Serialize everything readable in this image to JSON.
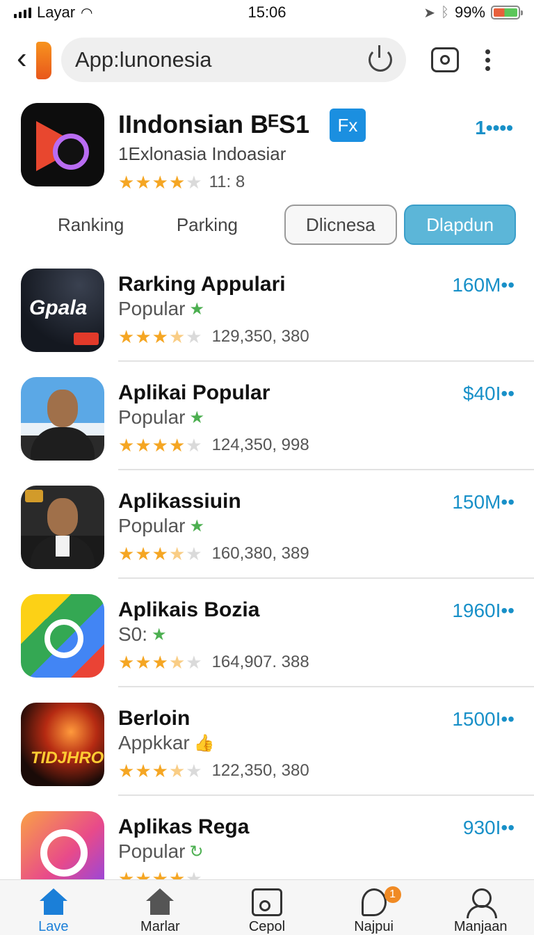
{
  "status": {
    "carrier": "Layar",
    "time": "15:06",
    "battery": "99%",
    "icons": [
      "signal-icon",
      "wifi-icon",
      "location-icon",
      "bluetooth-icon",
      "battery-icon"
    ]
  },
  "topbar": {
    "search_text": "App:lunonesia",
    "icons": [
      "back-icon",
      "power-icon",
      "camera-icon",
      "more-icon"
    ]
  },
  "app": {
    "title": "IIndonsian BᴱS1",
    "badge": "Fx",
    "subtitle": "1Exlonasia Indoasiar",
    "rating_text": "11: 8",
    "rating": 4,
    "more": "1••••"
  },
  "tabs": [
    {
      "label": "Ranking"
    },
    {
      "label": "Parking"
    },
    {
      "label": "Dlicnesa"
    },
    {
      "label": "Dlapdun"
    }
  ],
  "apps": [
    {
      "name": "Rarking Appulari",
      "category": "Popular",
      "count": "129,350, 380",
      "price": "160M••",
      "icon": "gpala",
      "icon_label": "Gpala",
      "rating": 3.5
    },
    {
      "name": "Aplikai Popular",
      "category": "Popular",
      "count": "124,350, 998",
      "price": "$40I••",
      "icon": "person",
      "rating": 4
    },
    {
      "name": "Aplikassiuin",
      "category": "Popular",
      "count": "160,380, 389",
      "price": "150M••",
      "icon": "person",
      "rating": 3.5
    },
    {
      "name": "Aplikais Bozia",
      "category": "S0:",
      "count": "164,907. 388",
      "price": "1960I••",
      "icon": "play",
      "rating": 3.5
    },
    {
      "name": "Berloin",
      "category": "Appkkar",
      "count": "122,350, 380",
      "price": "1500I••",
      "icon": "movie",
      "icon_label": "TIDJHRO",
      "rating": 3.5
    },
    {
      "name": "Aplikas Rega",
      "category": "Popular",
      "count": "",
      "price": "930I••",
      "icon": "insta",
      "rating": 4
    }
  ],
  "nav": [
    {
      "label": "Lave",
      "icon": "home-icon",
      "active": true
    },
    {
      "label": "Marlar",
      "icon": "store-icon"
    },
    {
      "label": "Cepol",
      "icon": "folder-icon"
    },
    {
      "label": "Najpui",
      "icon": "phone-icon",
      "badge": "1"
    },
    {
      "label": "Manjaan",
      "icon": "user-icon"
    }
  ],
  "colors": {
    "accent": "#1890c8",
    "active_tab": "#5cb6d8",
    "star": "#f5a623",
    "nav_active": "#1b7fd8"
  }
}
